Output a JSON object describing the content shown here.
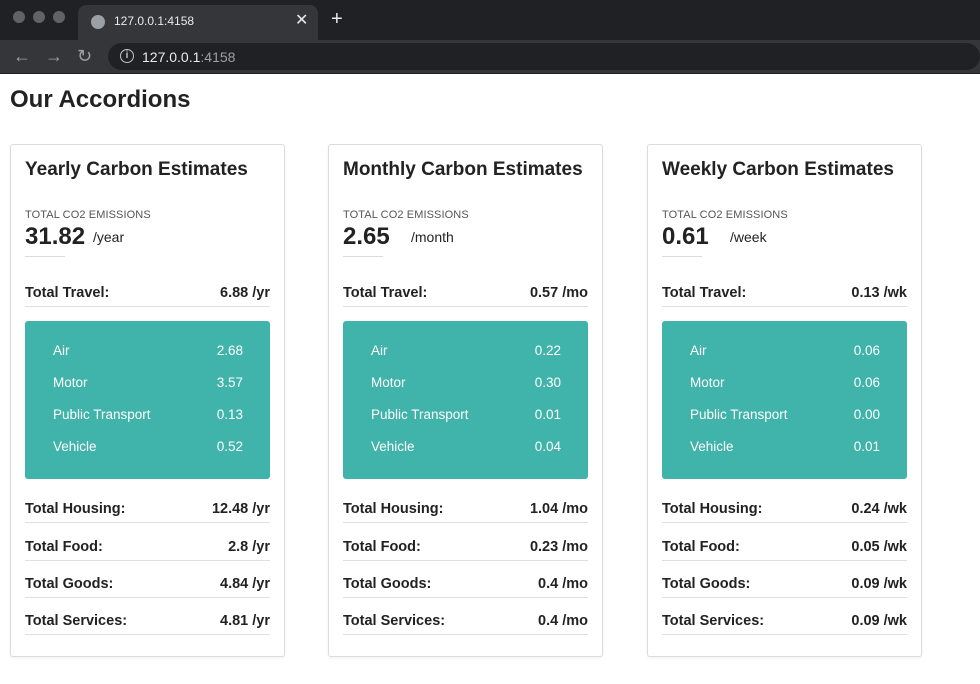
{
  "browser": {
    "tab_title": "127.0.0.1:4158",
    "tab_close": "✕",
    "new_tab": "+",
    "url_host": "127.0.0.1",
    "url_port": ":4158",
    "back_icon": "←",
    "forward_icon": "→",
    "reload_icon": "↻",
    "info_icon": "i"
  },
  "page": {
    "title": "Our Accordions"
  },
  "cards": [
    {
      "title": "Yearly Carbon Estimates",
      "emissions_label": "TOTAL CO2 EMISSIONS",
      "emissions_value": "31.82",
      "emissions_unit": "/year",
      "travel": {
        "label": "Total Travel:",
        "value": "6.88 /yr"
      },
      "breakdown": [
        {
          "label": "Air",
          "value": "2.68"
        },
        {
          "label": "Motor",
          "value": "3.57"
        },
        {
          "label": "Public Transport",
          "value": "0.13"
        },
        {
          "label": "Vehicle",
          "value": "0.52"
        }
      ],
      "housing": {
        "label": "Total Housing:",
        "value": "12.48 /yr"
      },
      "food": {
        "label": "Total Food:",
        "value": "2.8 /yr"
      },
      "goods": {
        "label": "Total Goods:",
        "value": "4.84 /yr"
      },
      "services": {
        "label": "Total Services:",
        "value": "4.81 /yr"
      }
    },
    {
      "title": "Monthly Carbon Estimates",
      "emissions_label": "TOTAL CO2 EMISSIONS",
      "emissions_value": "2.65",
      "emissions_unit": "/month",
      "travel": {
        "label": "Total Travel:",
        "value": "0.57 /mo"
      },
      "breakdown": [
        {
          "label": "Air",
          "value": "0.22"
        },
        {
          "label": "Motor",
          "value": "0.30"
        },
        {
          "label": "Public Transport",
          "value": "0.01"
        },
        {
          "label": "Vehicle",
          "value": "0.04"
        }
      ],
      "housing": {
        "label": "Total Housing:",
        "value": "1.04 /mo"
      },
      "food": {
        "label": "Total Food:",
        "value": "0.23 /mo"
      },
      "goods": {
        "label": "Total Goods:",
        "value": "0.4 /mo"
      },
      "services": {
        "label": "Total Services:",
        "value": "0.4 /mo"
      }
    },
    {
      "title": "Weekly Carbon Estimates",
      "emissions_label": "TOTAL CO2 EMISSIONS",
      "emissions_value": "0.61",
      "emissions_unit": "/week",
      "travel": {
        "label": "Total Travel:",
        "value": "0.13 /wk"
      },
      "breakdown": [
        {
          "label": "Air",
          "value": "0.06"
        },
        {
          "label": "Motor",
          "value": "0.06"
        },
        {
          "label": "Public Transport",
          "value": "0.00"
        },
        {
          "label": "Vehicle",
          "value": "0.01"
        }
      ],
      "housing": {
        "label": "Total Housing:",
        "value": "0.24 /wk"
      },
      "food": {
        "label": "Total Food:",
        "value": "0.05 /wk"
      },
      "goods": {
        "label": "Total Goods:",
        "value": "0.09 /wk"
      },
      "services": {
        "label": "Total Services:",
        "value": "0.09 /wk"
      }
    }
  ],
  "colors": {
    "accent": "#40b3aa",
    "chrome_dark": "#202124",
    "chrome_mid": "#35363a"
  }
}
